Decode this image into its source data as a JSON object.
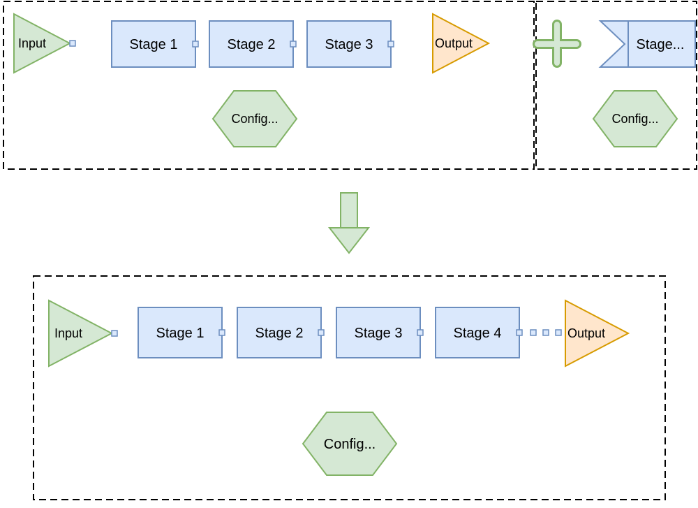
{
  "colors": {
    "greenFill": "#d5e8d4",
    "greenStroke": "#82b366",
    "blueFill": "#dae8fc",
    "blueStroke": "#6c8ebf",
    "orangeFill": "#ffe6cc",
    "orangeStroke": "#d79b00",
    "dashStroke": "#000000"
  },
  "top": {
    "input": "Input",
    "stages": [
      "Stage 1",
      "Stage 2",
      "Stage 3"
    ],
    "output": "Output",
    "config": "Config..."
  },
  "addBlock": {
    "plus": "+",
    "stage": "Stage...",
    "config": "Config..."
  },
  "bottom": {
    "input": "Input",
    "stages": [
      "Stage 1",
      "Stage 2",
      "Stage 3",
      "Stage 4"
    ],
    "output": "Output",
    "config": "Config..."
  }
}
